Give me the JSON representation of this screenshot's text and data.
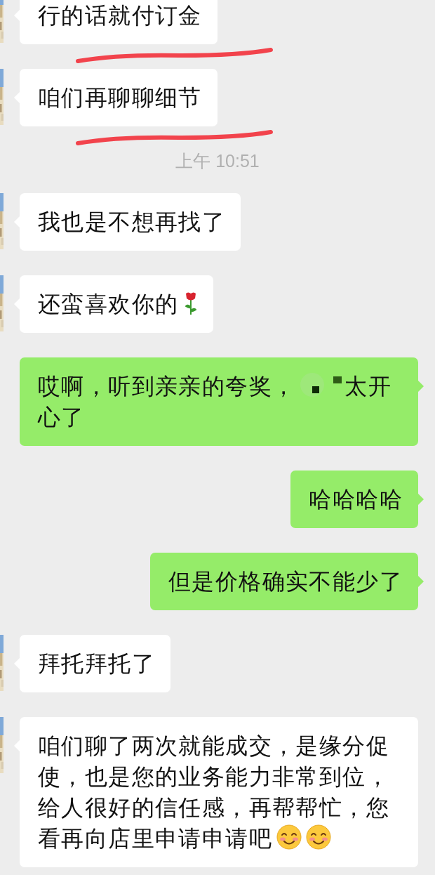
{
  "messages": [
    {
      "outgoing": false,
      "underlined": true,
      "parts": [
        {
          "kind": "text",
          "text": "行的话就付订金"
        }
      ]
    },
    {
      "outgoing": false,
      "underlined": true,
      "parts": [
        {
          "kind": "text",
          "text": "咱们再聊聊细节"
        }
      ]
    },
    {
      "time": "上午 10:51"
    },
    {
      "outgoing": false,
      "underlined": false,
      "parts": [
        {
          "kind": "text",
          "text": "我也是不想再找了"
        }
      ]
    },
    {
      "outgoing": false,
      "underlined": false,
      "parts": [
        {
          "kind": "text",
          "text": "还蛮喜欢你的"
        },
        {
          "kind": "rose"
        }
      ]
    },
    {
      "outgoing": true,
      "underlined": false,
      "parts": [
        {
          "kind": "text",
          "text": "哎啊，听到亲亲的夸奖，"
        },
        {
          "kind": "pixelated"
        },
        {
          "kind": "text",
          "text": "太开心了"
        }
      ]
    },
    {
      "outgoing": true,
      "underlined": false,
      "parts": [
        {
          "kind": "text",
          "text": "哈哈哈哈"
        }
      ]
    },
    {
      "outgoing": true,
      "underlined": false,
      "parts": [
        {
          "kind": "text",
          "text": "但是价格确实不能少了"
        }
      ]
    },
    {
      "outgoing": false,
      "underlined": false,
      "parts": [
        {
          "kind": "text",
          "text": "拜托拜托了"
        }
      ]
    },
    {
      "outgoing": false,
      "underlined": false,
      "parts": [
        {
          "kind": "text",
          "text": "咱们聊了两次就能成交，是缘分促使，也是您的业务能力非常到位，给人很好的信任感，再帮帮忙，您看再向店里申请申请吧"
        },
        {
          "kind": "smile"
        },
        {
          "kind": "smile"
        }
      ]
    }
  ]
}
